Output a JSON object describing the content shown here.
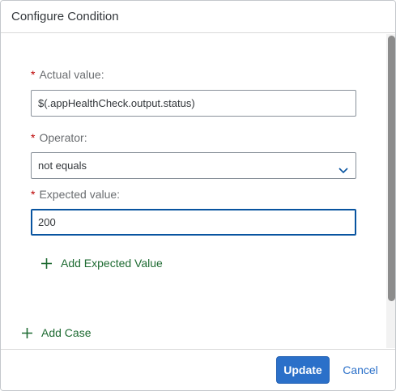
{
  "dialog": {
    "title": "Configure Condition"
  },
  "form": {
    "actual_value": {
      "label": "Actual value:",
      "required_mark": "*",
      "value": "$(.appHealthCheck.output.status)"
    },
    "operator": {
      "label": "Operator:",
      "required_mark": "*",
      "selected": "not equals"
    },
    "expected_value": {
      "label": "Expected value:",
      "required_mark": "*",
      "value": "200"
    },
    "add_expected_value_label": "Add Expected Value",
    "add_case_label": "Add Case"
  },
  "footer": {
    "update_label": "Update",
    "cancel_label": "Cancel"
  },
  "icons": {
    "add": "plus-icon",
    "dropdown": "chevron-down-icon"
  },
  "colors": {
    "accent": "#2b70c9",
    "link_green": "#1e6b32",
    "required": "#bb0000"
  }
}
